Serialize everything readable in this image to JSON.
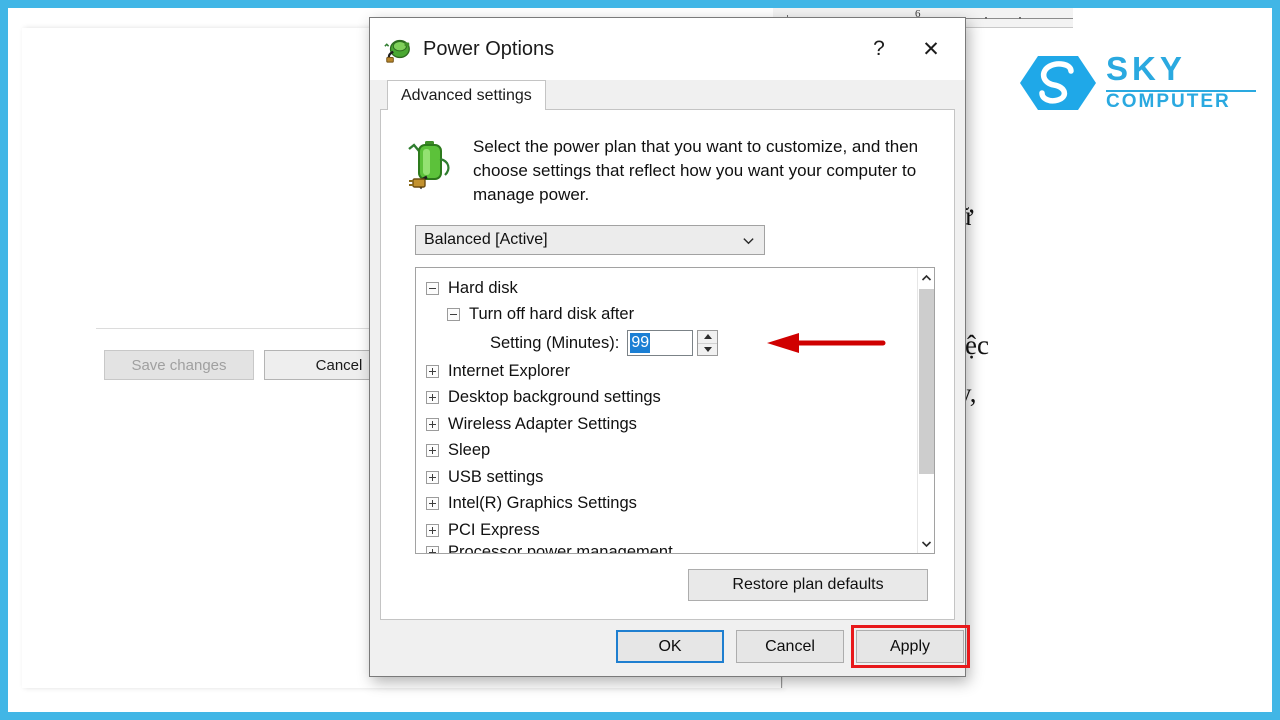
{
  "background": {
    "doc_text_fragments": [
      "ữ",
      "việc",
      "ày,"
    ],
    "ruler_number": "6",
    "buttons": {
      "save_changes": "Save changes",
      "cancel": "Cancel"
    }
  },
  "logo": {
    "primary": "SKY",
    "secondary": "COMPUTER",
    "color": "#2aa9e0"
  },
  "dialog": {
    "title": "Power Options",
    "title_icon": "power-plug-battery-icon",
    "help_label": "?",
    "close_label": "✕",
    "tab": {
      "label": "Advanced settings"
    },
    "blurb": "Select the power plan that you want to customize, and then choose settings that reflect how you want your computer to manage power.",
    "plan_select": {
      "value": "Balanced [Active]",
      "caret_icon": "chevron-down-icon"
    },
    "tree": {
      "items": [
        {
          "label": "Hard disk",
          "level": 1,
          "expanded": true
        },
        {
          "label": "Turn off hard disk after",
          "level": 2,
          "expanded": true
        },
        {
          "label": "Internet Explorer",
          "level": 1,
          "expanded": false
        },
        {
          "label": "Desktop background settings",
          "level": 1,
          "expanded": false
        },
        {
          "label": "Wireless Adapter Settings",
          "level": 1,
          "expanded": false
        },
        {
          "label": "Sleep",
          "level": 1,
          "expanded": false
        },
        {
          "label": "USB settings",
          "level": 1,
          "expanded": false
        },
        {
          "label": "Intel(R) Graphics Settings",
          "level": 1,
          "expanded": false
        },
        {
          "label": "PCI Express",
          "level": 1,
          "expanded": false
        },
        {
          "label": "Processor power management",
          "level": 1,
          "expanded": false
        }
      ],
      "setting": {
        "label": "Setting (Minutes):",
        "value": "99",
        "selected": true,
        "highlight_color": "#1b7fd4"
      }
    },
    "restore_button": "Restore plan defaults",
    "footer": {
      "ok": "OK",
      "cancel": "Cancel",
      "apply": "Apply"
    }
  },
  "annotations": {
    "arrow_color": "#cf0000",
    "apply_highlight_color": "#e8191b"
  }
}
